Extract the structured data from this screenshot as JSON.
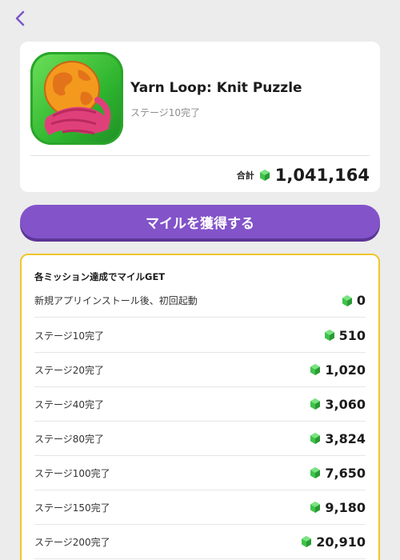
{
  "header": {
    "back_icon": "chevron-left-icon"
  },
  "app": {
    "title": "Yarn Loop: Knit Puzzle",
    "subtitle": "ステージ10完了",
    "icon": "yarn-ball-globe-icon"
  },
  "total": {
    "label": "合計",
    "value": "1,041,164",
    "icon": "green-gem-icon"
  },
  "earn_button": {
    "label": "マイルを獲得する"
  },
  "missions": {
    "heading": "各ミッション達成でマイルGET",
    "items": [
      {
        "label": "新規アプリインストール後、初回起動",
        "value": "0"
      },
      {
        "label": "ステージ10完了",
        "value": "510"
      },
      {
        "label": "ステージ20完了",
        "value": "1,020"
      },
      {
        "label": "ステージ40完了",
        "value": "3,060"
      },
      {
        "label": "ステージ80完了",
        "value": "3,824"
      },
      {
        "label": "ステージ100完了",
        "value": "7,650"
      },
      {
        "label": "ステージ150完了",
        "value": "9,180"
      },
      {
        "label": "ステージ200完了",
        "value": "20,910"
      }
    ]
  },
  "colors": {
    "accent": "#8253c9",
    "highlight_border": "#f2c52b",
    "gem": "#3fc34a"
  }
}
